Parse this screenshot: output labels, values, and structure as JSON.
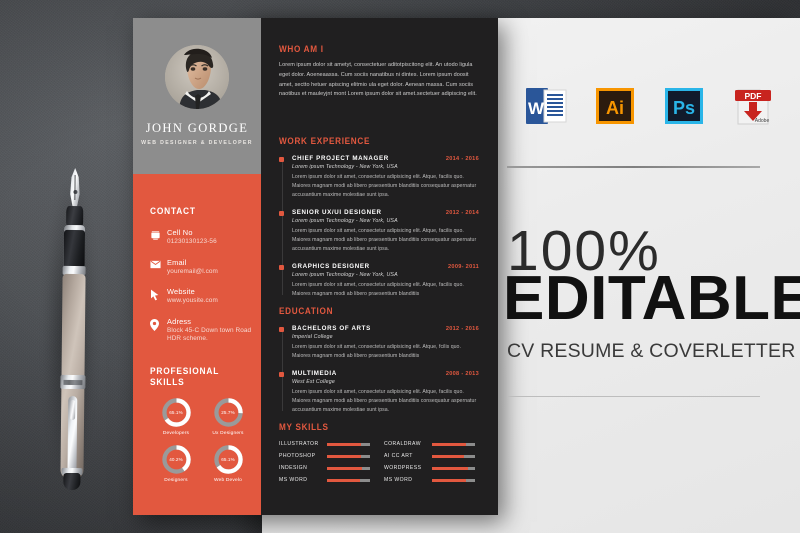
{
  "colors": {
    "accent": "#e2583f",
    "dark_panel": "#201f20",
    "gray_header": "#8d8d8d",
    "page_bg": "#ededed",
    "backdrop": "#4a4c50"
  },
  "resume": {
    "profile": {
      "name": "JOHN GORDGE",
      "role": "WEB DESIGNER & DEVELOPER"
    },
    "contact": {
      "heading": "CONTACT",
      "items": [
        {
          "icon": "phone-icon",
          "label": "Cell No",
          "value": "01230130123-56"
        },
        {
          "icon": "envelope-icon",
          "label": "Email",
          "value": "youremail@l.com"
        },
        {
          "icon": "cursor-icon",
          "label": "Website",
          "value": "www.yousite.com"
        },
        {
          "icon": "location-pin-icon",
          "label": "Adress",
          "value": "Block 45-C Down town Road HDR scheme."
        }
      ]
    },
    "professional_skills": {
      "heading": "PROFESIONAL SKILLS",
      "donuts": [
        {
          "label": "Developers",
          "percent": "65.1%",
          "value": 65.1
        },
        {
          "label": "Ux Designers",
          "percent": "25.7%",
          "value": 25.7
        },
        {
          "label": "Designers",
          "percent": "40.2%",
          "value": 40.2
        },
        {
          "label": "Web Develo",
          "percent": "65.1%",
          "value": 65.1
        }
      ]
    },
    "who_am_i": {
      "heading": "WHO AM I",
      "text": "Lorem ipsum dolor sit ametyt, consectetuer aditotpiscitong elit. An utodo ligula eget dolor. Aoeneaassa. Cum sociis nanatibus ni dintes. Lorem ipsum doosit amet, sectto hetuer apiscing elitmio ula eget dolor. Aenean massa. Cum sociis naotibus et mauleyjnt mont Lorem ipsum dolor sit amet.sectetuer adipiscing elit."
    },
    "work_experience": {
      "heading": "WORK EXPERIENCE",
      "items": [
        {
          "job": "CHIEF PROJECT MANAGER",
          "date": "2014 - 2016",
          "company": "Lorem ipsum Technology - New York, USA",
          "desc": "Lorem ipsum dolor sit amet, consectetur adipisicing elit. Atque, facilis quo. Maiores magnam modi ab libero praesentium blanditiis consequatur aspernatur accusantium maxime molestiae sunt ipsa."
        },
        {
          "job": "SENIOR UX/UI DESIGNER",
          "date": "2012 - 2014",
          "company": "Lorem ipsum Technology - New York, USA",
          "desc": "Lorem ipsum dolor sit amet, consectetur adipisicing elit. Atque, facilis quo. Maiores magnam modi ab libero praesentium blanditiis consequatur aspernatur accusantium maxime molestiae sunt ipsa."
        },
        {
          "job": "GRAPHICS DESIGNER",
          "date": "2009- 2011",
          "company": "Lorem ipsum Technology - New York, USA",
          "desc": "Lorem ipsum dolor sit amet, consectetur adipisicing elit. Atque, facilis quo. Maiores magnam modi ab libero praesentium blanditiis"
        }
      ]
    },
    "education": {
      "heading": "EDUCATION",
      "items": [
        {
          "job": "BACHELORS OF ARTS",
          "date": "2012 - 2016",
          "company": "Imperial College",
          "desc": "Lorem ipsum dolor sit amet, consectetur adipisicing elit. Atque, fcilis quo. Maiores magnam modi ab libero praesentium blanditiis"
        },
        {
          "job": "MULTIMEDIA",
          "date": "2008 - 2013",
          "company": "West Est College",
          "desc": "Lorem ipsum dolor sit amet, consectetur adipisicing elit. Atque, facilis quo. Maiores magnam modi ab libero praesentium blanditiis consequatur aspernatur accusantium maxime molestiae sunt ipsa."
        }
      ]
    },
    "my_skills": {
      "heading": "MY SKILLS",
      "left": [
        {
          "name": "ILLUSTRATOR",
          "value": 80
        },
        {
          "name": "PHOTOSHOP",
          "value": 78
        },
        {
          "name": "INDESIGN",
          "value": 82
        },
        {
          "name": "MS WORD",
          "value": 76
        }
      ],
      "right": [
        {
          "name": "CORALDRAW",
          "value": 80
        },
        {
          "name": "AI CC ART",
          "value": 74
        },
        {
          "name": "WORDPRESS",
          "value": 84
        },
        {
          "name": "MS WORD",
          "value": 78
        }
      ]
    }
  },
  "marketing": {
    "app_icons": [
      {
        "name": "word-icon",
        "letter": "W"
      },
      {
        "name": "illustrator-icon",
        "letter": "Ai"
      },
      {
        "name": "photoshop-icon",
        "letter": "Ps"
      },
      {
        "name": "pdf-icon",
        "letter": "PDF",
        "sublabel": "Adobe"
      }
    ],
    "headline_top": "100%",
    "headline_main": "EDITABLE",
    "subtitle": "CV RESUME & COVERLETTER"
  }
}
